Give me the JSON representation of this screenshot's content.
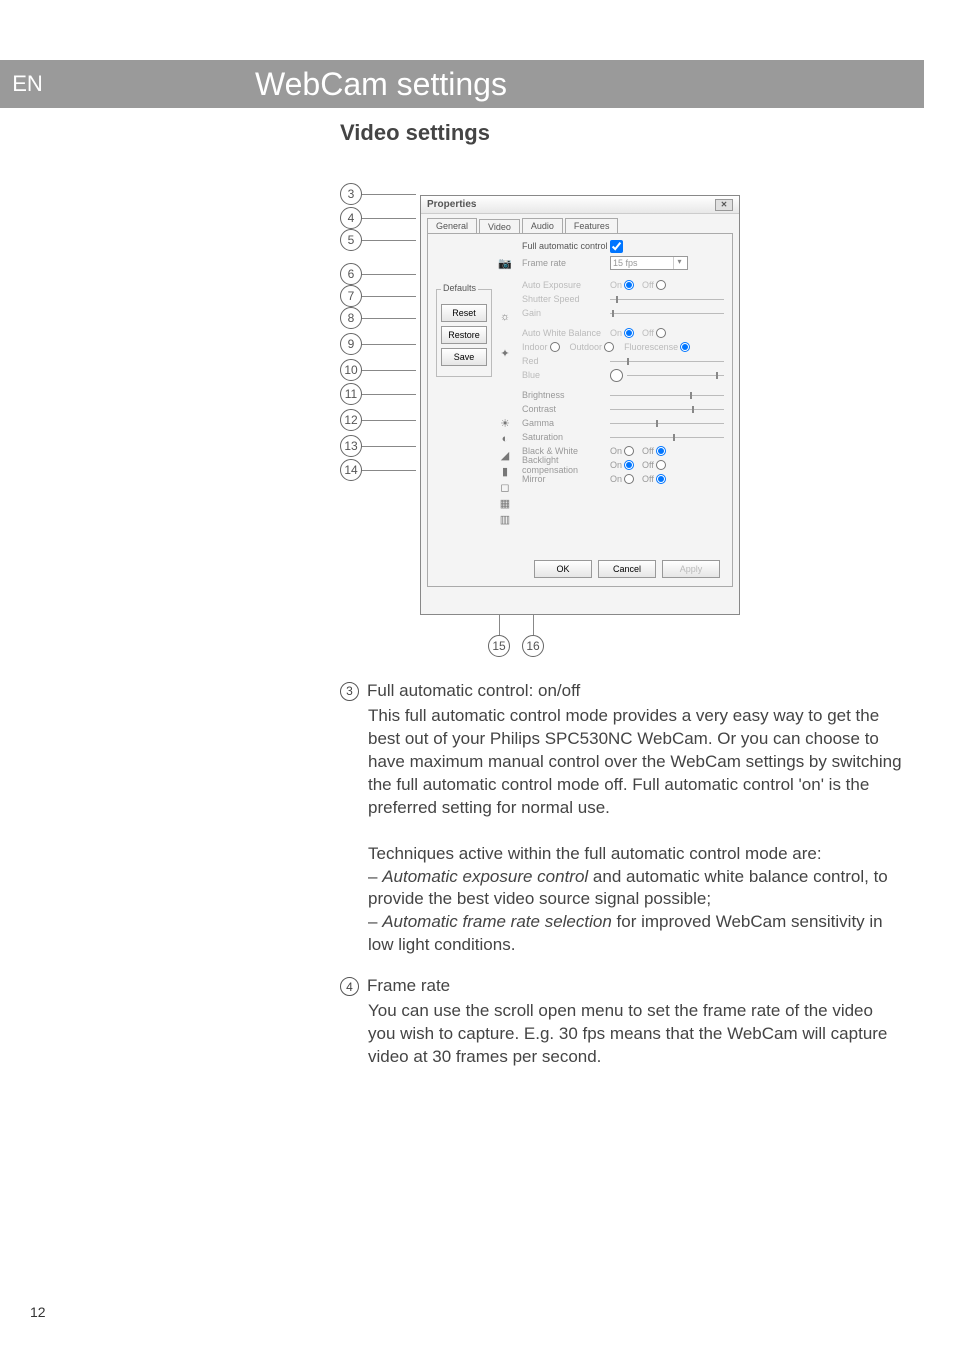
{
  "lang": "EN",
  "banner": "WebCam settings",
  "section": "Video settings",
  "pagenum": "12",
  "callouts_left": [
    "3",
    "4",
    "5",
    "6",
    "7",
    "8",
    "9",
    "10",
    "11",
    "12",
    "13",
    "14"
  ],
  "callouts_bottom": [
    "15",
    "16"
  ],
  "dialog": {
    "title": "Properties",
    "tabs": [
      "General",
      "Video",
      "Audio",
      "Features"
    ],
    "active_tab": "Video",
    "full_auto_label": "Full automatic control",
    "defaults_legend": "Defaults",
    "btn_reset": "Reset",
    "btn_restore": "Restore",
    "btn_save": "Save",
    "rows": {
      "frame_rate": "Frame rate",
      "frame_rate_value": "15 fps",
      "auto_exposure": "Auto Exposure",
      "shutter_speed": "Shutter Speed",
      "gain": "Gain",
      "auto_wb": "Auto White Balance",
      "indoor": "Indoor",
      "outdoor": "Outdoor",
      "fluor": "Fluorescense",
      "red": "Red",
      "blue": "Blue",
      "brightness": "Brightness",
      "contrast": "Contrast",
      "gamma": "Gamma",
      "saturation": "Saturation",
      "bw": "Black & White",
      "backlight": "Backlight compensation",
      "mirror": "Mirror",
      "on": "On",
      "off": "Off"
    },
    "footer": {
      "ok": "OK",
      "cancel": "Cancel",
      "apply": "Apply"
    }
  },
  "explain": {
    "item3_num": "3",
    "item3_title": "Full automatic control: on/off",
    "item3_p1": "This full automatic control mode provides a very easy way to get the best out of your Philips SPC530NC WebCam. Or you can choose to have maximum manual control over the WebCam settings by switching the full automatic control mode off. Full automatic control 'on' is the preferred setting for normal use.",
    "item3_p2": "Techniques active within the full automatic control mode are:",
    "item3_b1a": "Automatic exposure control",
    "item3_b1b": " and automatic white balance control, to provide the best video source signal possible;",
    "item3_b2a": "Automatic frame rate selection",
    "item3_b2b": " for improved WebCam sensitivity in low light conditions.",
    "item4_num": "4",
    "item4_title": "Frame rate",
    "item4_p1": "You can use the scroll open menu to set the frame rate of the video you wish to capture. E.g. 30 fps means that the WebCam will capture video at 30 frames per second."
  }
}
